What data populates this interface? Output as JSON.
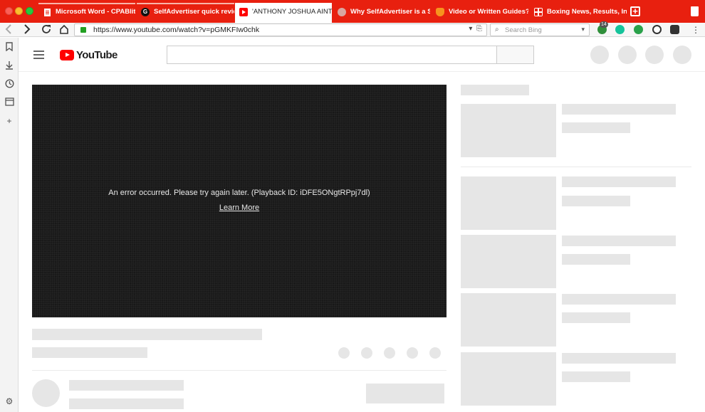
{
  "browser": {
    "tabs": [
      {
        "title": "Microsoft Word - CPABlitz.do",
        "icon": "document-icon",
        "icon_color": "#e8200f"
      },
      {
        "title": "SelfAdvertiser quick review -",
        "icon": "g-logo-icon",
        "icon_color": "#111111"
      },
      {
        "title": "'ANTHONY JOSHUA AINT GO",
        "icon": "youtube-icon",
        "icon_color": "#ff0000",
        "active": true
      },
      {
        "title": "Why SelfAdvertiser is a Self-S",
        "icon": "globe-icon",
        "icon_color": "#d9a6a0"
      },
      {
        "title": "Video or Written Guides? | af",
        "icon": "orange-logo-icon",
        "icon_color": "#f7931e"
      },
      {
        "title": "Boxing News, Results, Intervi",
        "icon": "grid-logo-icon",
        "icon_color": "#ffffff"
      }
    ],
    "new_tab_label": "+",
    "url": "https://www.youtube.com/watch?v=pGMKFIw0chk",
    "search_placeholder": "Search Bing",
    "extension_badge": "14",
    "accent_color": "#e8200f"
  },
  "player": {
    "error_message": "An error occurred. Please try again later. (Playback ID: iDFE5ONgtRPpj7dl)",
    "learn_more": "Learn More"
  }
}
